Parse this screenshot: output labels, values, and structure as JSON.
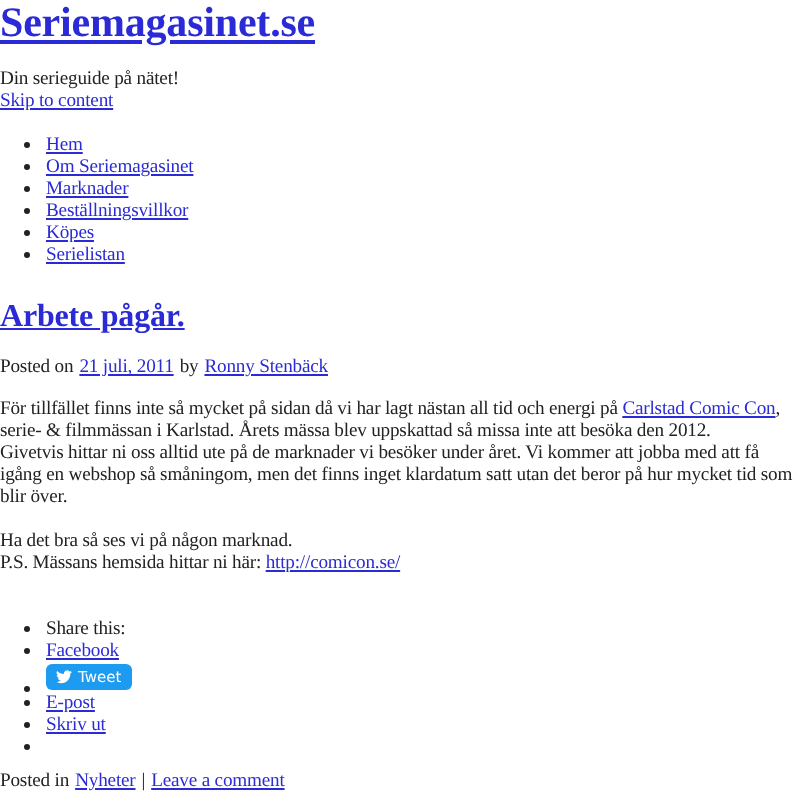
{
  "site_title": "Seriemagasinet.se",
  "tagline": "Din serieguide på nätet!",
  "skip_link": "Skip to content",
  "nav": [
    {
      "label": "Hem"
    },
    {
      "label": "Om Seriemagasinet"
    },
    {
      "label": "Marknader"
    },
    {
      "label": "Beställningsvillkor"
    },
    {
      "label": "Köpes"
    },
    {
      "label": "Serielistan"
    }
  ],
  "post": {
    "title": "Arbete pågår.",
    "posted_on": "Posted on",
    "date": "21 juli, 2011",
    "by": "by",
    "author": "Ronny Stenbäck",
    "paragraphs": [
      {
        "before": "För tillfället finns inte så mycket på sidan då vi har lagt nästan all tid och energi på",
        "link": "Carlstad Comic Con",
        "after": ", serie- & filmmässan i Karlstad. Årets mässa blev uppskattad så missa inte att besöka den 2012."
      },
      {
        "before": "Givetvis hittar ni oss alltid ute på de marknader vi besöker under året. Vi kommer att jobba med att få igång en webshop så småningom, men det finns inget klardatum satt utan det beror på hur mycket tid som blir över."
      }
    ],
    "closing": "Ha det bra så ses vi på någon marknad.",
    "ps": {
      "before": "P.S. Mässans hemsida hittar ni här:",
      "link": "http://comicon.se/"
    }
  },
  "share": [
    {
      "kind": "label",
      "label": "Share this:"
    },
    {
      "kind": "link",
      "label": "Facebook"
    },
    {
      "kind": "tweet",
      "label": "Tweet"
    },
    {
      "kind": "link",
      "label": "E-post"
    },
    {
      "kind": "link",
      "label": "Skriv ut"
    },
    {
      "kind": "empty"
    }
  ],
  "footer": {
    "posted_in": "Posted in",
    "category": "Nyheter",
    "separator": "|",
    "comment": "Leave a comment"
  }
}
